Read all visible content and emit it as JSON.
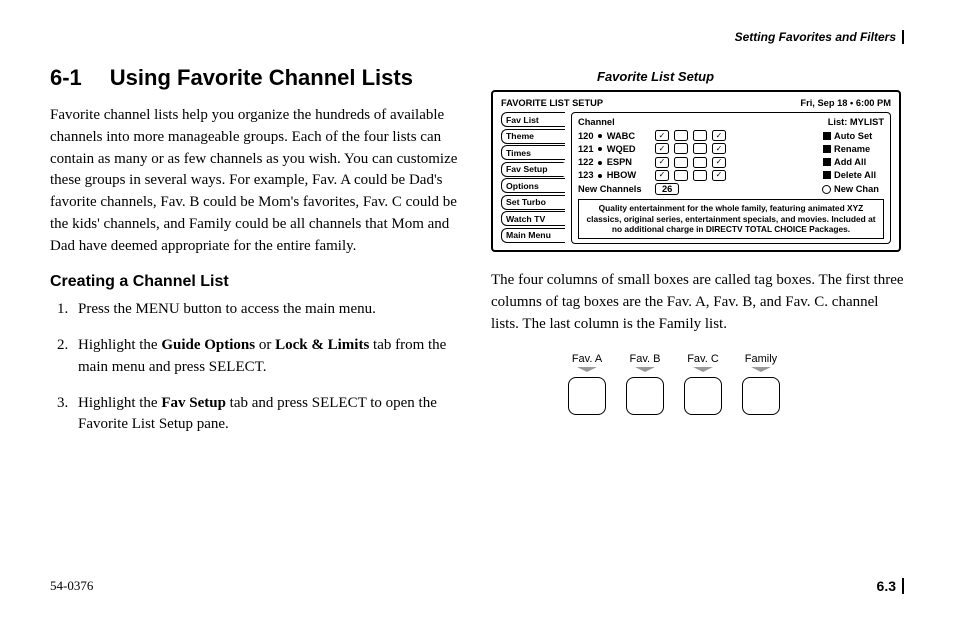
{
  "header": {
    "section": "Setting Favorites and Filters"
  },
  "title": {
    "number": "6-1",
    "text": "Using Favorite Channel Lists"
  },
  "intro": "Favorite channel lists help you organize the hundreds of available channels into more manageable groups. Each of the four lists can contain as many or as few channels as you wish. You can customize these groups in several ways. For example, Fav. A could be Dad's favorite channels, Fav. B could be Mom's favorites, Fav. C could be the kids' channels, and Family could be all channels that Mom and Dad have deemed appropriate for the entire family.",
  "subhead": "Creating a Channel List",
  "steps": {
    "s1": "Press the MENU button to access the main menu.",
    "s2a": "Highlight the ",
    "s2b": "Guide Options",
    "s2c": " or ",
    "s2d": "Lock & Limits",
    "s2e": " tab from the main menu and press SELECT.",
    "s3a": "Highlight the ",
    "s3b": "Fav Setup",
    "s3c": " tab and press SELECT to open the Favorite List Setup pane."
  },
  "figure": {
    "caption": "Favorite List Setup",
    "title": "FAVORITE LIST SETUP",
    "datetime": "Fri, Sep 18  •  6:00 PM",
    "tabs": [
      "Fav List",
      "Theme",
      "Times",
      "Fav Setup",
      "Options",
      "Set Turbo",
      "Watch TV",
      "Main Menu"
    ],
    "pane": {
      "channel_h": "Channel",
      "list_h": "List:  MYLIST",
      "rows": [
        {
          "num": "120",
          "call": "WABC"
        },
        {
          "num": "121",
          "call": "WQED"
        },
        {
          "num": "122",
          "call": "ESPN"
        },
        {
          "num": "123",
          "call": "HBOW"
        }
      ],
      "new_label": "New Channels",
      "new_count": "26",
      "btns": [
        "Auto Set",
        "Rename",
        "Add All",
        "Delete All",
        "New Chan"
      ],
      "desc": "Quality entertainment for the whole family, featuring animated XYZ classics, original series, entertainment specials, and movies. Included at no additional charge in DIRECTV TOTAL CHOICE Packages."
    }
  },
  "para2": "The four columns of small boxes are called tag boxes. The first three columns of tag boxes are the Fav. A, Fav. B, and Fav. C. channel lists. The last column is the Family list.",
  "tagdemo": {
    "labels": [
      "Fav. A",
      "Fav. B",
      "Fav. C",
      "Family"
    ]
  },
  "footer": {
    "left": "54-0376",
    "right": "6.3"
  }
}
